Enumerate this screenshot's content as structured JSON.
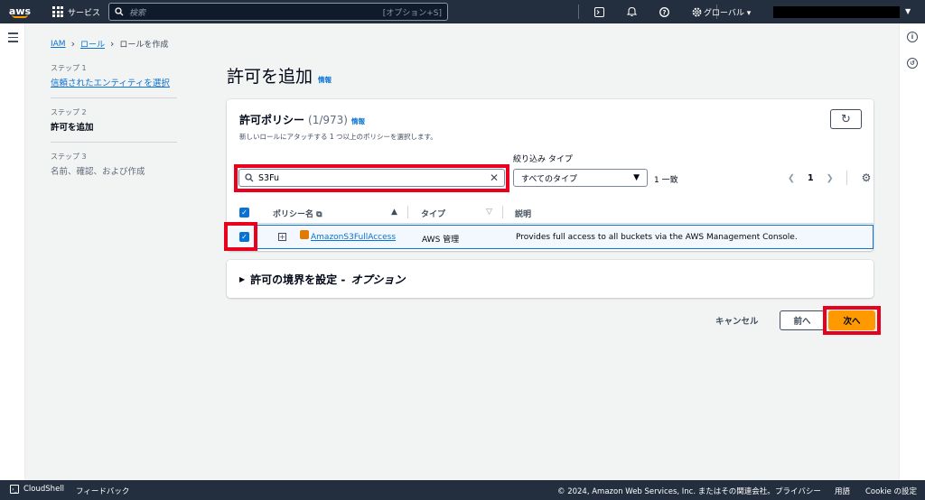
{
  "topnav": {
    "logo": "aws",
    "services": "サービス",
    "search_placeholder": "検索",
    "search_shortcut": "[オプション+S]",
    "region": "グローバル"
  },
  "breadcrumb": {
    "iam": "IAM",
    "roles": "ロール",
    "current": "ロールを作成"
  },
  "steps": [
    {
      "label": "ステップ 1",
      "title": "信頼されたエンティティを選択"
    },
    {
      "label": "ステップ 2",
      "title": "許可を追加"
    },
    {
      "label": "ステップ 3",
      "title": "名前、確認、および作成"
    }
  ],
  "page": {
    "title": "許可を追加",
    "info": "情報"
  },
  "policies": {
    "title": "許可ポリシー",
    "count": "(1/973)",
    "info": "情報",
    "description": "新しいロールにアタッチする 1 つ以上のポリシーを選択します。",
    "filter_label": "絞り込み タイプ",
    "search_value": "S3Fu",
    "type_filter": "すべてのタイプ",
    "match_count": "1 一致",
    "page": "1",
    "columns": {
      "name": "ポリシー名",
      "type": "タイプ",
      "description": "説明"
    },
    "rows": [
      {
        "name": "AmazonS3FullAccess",
        "type": "AWS 管理",
        "description": "Provides full access to all buckets via the AWS Management Console.",
        "selected": true
      }
    ]
  },
  "boundary": {
    "title": "許可の境界を設定 -",
    "optional": "オプション"
  },
  "actions": {
    "cancel": "キャンセル",
    "back": "前へ",
    "next": "次へ"
  },
  "footer": {
    "cloudshell": "CloudShell",
    "feedback": "フィードバック",
    "copyright": "© 2024, Amazon Web Services, Inc. またはその関連会社。",
    "privacy": "プライバシー",
    "terms": "用語",
    "cookie": "Cookie の設定"
  },
  "colors": {
    "nav_bg": "#232f3e",
    "link": "#0972d3",
    "primary_button": "#ff9900",
    "highlight": "#e8001c"
  }
}
